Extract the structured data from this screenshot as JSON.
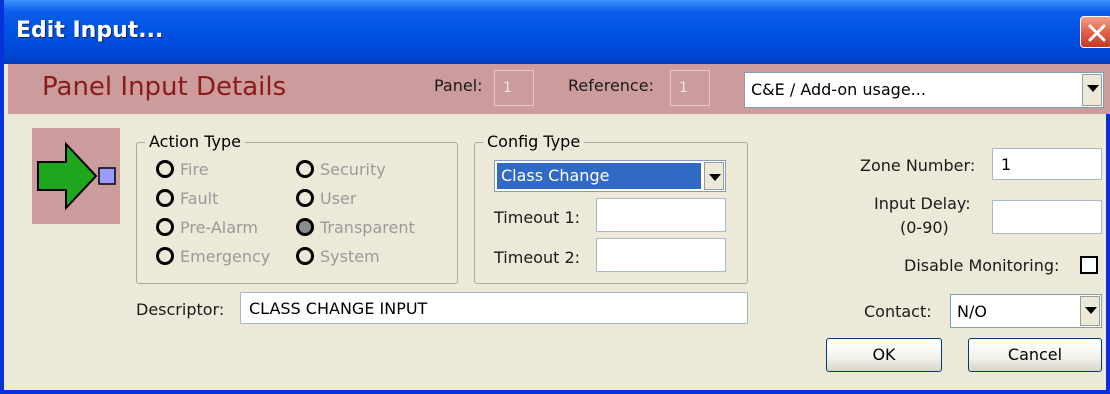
{
  "window": {
    "title": "Edit Input..."
  },
  "header": {
    "title": "Panel Input Details",
    "panel_label": "Panel:",
    "panel_value": "1",
    "reference_label": "Reference:",
    "reference_value": "1",
    "usage_value": "C&E / Add-on usage..."
  },
  "action_type": {
    "legend": "Action Type",
    "options": [
      {
        "label": "Fire",
        "selected": false
      },
      {
        "label": "Security",
        "selected": false
      },
      {
        "label": "Fault",
        "selected": false
      },
      {
        "label": "User",
        "selected": false
      },
      {
        "label": "Pre-Alarm",
        "selected": false
      },
      {
        "label": "Transparent",
        "selected": true
      },
      {
        "label": "Emergency",
        "selected": false
      },
      {
        "label": "System",
        "selected": false
      }
    ]
  },
  "config_type": {
    "legend": "Config Type",
    "selected": "Class Change",
    "timeout1_label": "Timeout 1:",
    "timeout1_value": "",
    "timeout2_label": "Timeout 2:",
    "timeout2_value": ""
  },
  "descriptor": {
    "label": "Descriptor:",
    "value": "CLASS CHANGE INPUT"
  },
  "right": {
    "zone_label": "Zone Number:",
    "zone_value": "1",
    "delay_label": "Input Delay:",
    "delay_range": "(0-90)",
    "delay_value": "",
    "disable_label": "Disable Monitoring:",
    "disable_checked": false,
    "contact_label": "Contact:",
    "contact_value": "N/O"
  },
  "buttons": {
    "ok": "OK",
    "cancel": "Cancel"
  },
  "colors": {
    "accent": "#0054e3",
    "header_band": "#cc9c9c",
    "header_title": "#8b1a1a",
    "arrow": "#1fa81f",
    "selection": "#316ac5"
  }
}
